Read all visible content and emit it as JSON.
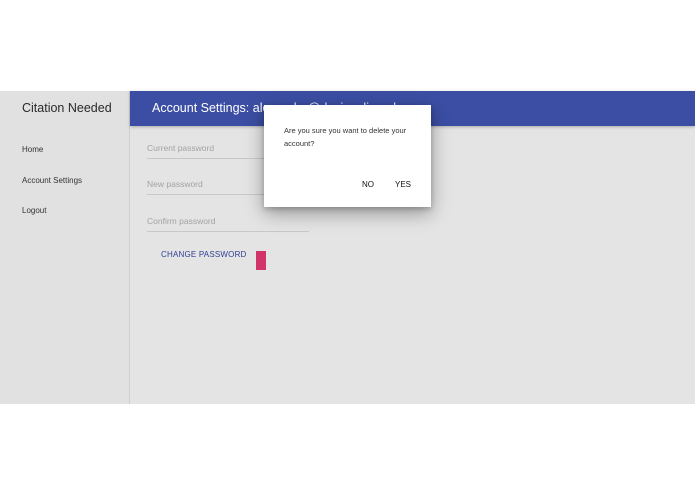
{
  "sidebar": {
    "brand": "Citation Needed",
    "items": [
      {
        "label": "Home"
      },
      {
        "label": "Account Settings"
      },
      {
        "label": "Logout"
      }
    ]
  },
  "header": {
    "title": "Account Settings: alexander@davisonline.uk"
  },
  "form": {
    "current_password_placeholder": "Current password",
    "new_password_placeholder": "New password",
    "confirm_password_placeholder": "Confirm password",
    "current_password_icon": "password-manager-icon",
    "new_password_icon": "key-icon",
    "change_password_label": "CHANGE PASSWORD",
    "delete_button_color": "#d03468"
  },
  "dialog": {
    "message": "Are you sure you want to delete your account?",
    "no_label": "NO",
    "yes_label": "YES"
  },
  "colors": {
    "header_bg": "#3b4ea3",
    "accent_text": "#2f3f95",
    "danger": "#d03468"
  }
}
